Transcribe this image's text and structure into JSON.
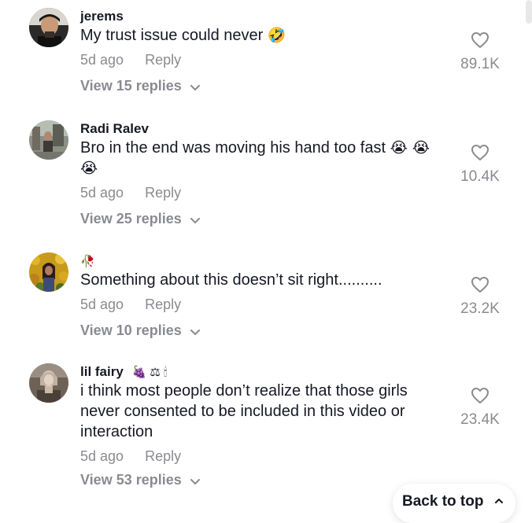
{
  "comments": [
    {
      "username": "jerems",
      "username_emojis": "",
      "text": "My trust issue could never",
      "text_emojis": "🤣",
      "time": "5d ago",
      "reply_label": "Reply",
      "view_replies": "View 15 replies",
      "likes": "89.1K",
      "avatar": "dark-portrait-avatar"
    },
    {
      "username": "Radi Ralev",
      "username_emojis": "",
      "text": "Bro in the end was moving his hand too fast",
      "text_emojis": "😭 😭 😭",
      "time": "5d ago",
      "reply_label": "Reply",
      "view_replies": "View 25 replies",
      "likes": "10.4K",
      "avatar": "street-photo-avatar"
    },
    {
      "username": "",
      "username_emojis": "🥀",
      "text": "Something about this doesn’t sit right..........",
      "text_emojis": "",
      "time": "5d ago",
      "reply_label": "Reply",
      "view_replies": "View 10 replies",
      "likes": "23.2K",
      "avatar": "flower-field-avatar"
    },
    {
      "username": "lil fairy",
      "username_emojis": "🍇 ⚖ 🕯",
      "text": "i think most people don’t realize that those girls never consented to be included in this video or interaction",
      "text_emojis": "",
      "time": "5d ago",
      "reply_label": "Reply",
      "view_replies": "View 53 replies",
      "likes": "23.4K",
      "avatar": "mirror-selfie-avatar"
    }
  ],
  "back_to_top": "Back to top",
  "colors": {
    "text": "#161823",
    "muted": "#8a8b91",
    "background": "#ffffff"
  },
  "icons": {
    "like": "heart-outline-icon",
    "expand": "chevron-down-icon",
    "back_to_top": "chevron-up-icon"
  }
}
